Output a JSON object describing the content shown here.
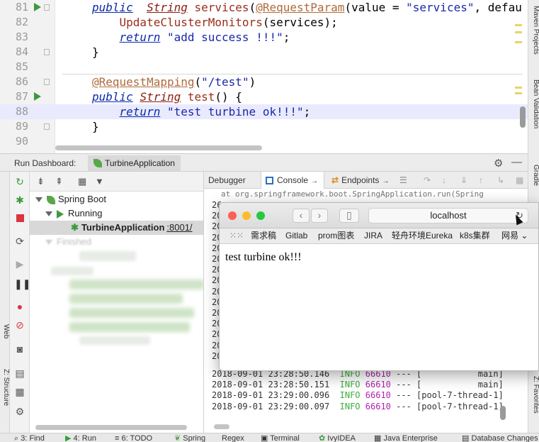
{
  "editor": {
    "lines": [
      {
        "num": "81",
        "run": true,
        "fold": true,
        "parts": [
          [
            "kw",
            "public"
          ],
          [
            "",
            "  "
          ],
          [
            "ty",
            "String"
          ],
          [
            "",
            ""
          ],
          [
            "fn",
            " services"
          ],
          [
            "",
            "("
          ],
          [
            "an",
            "@RequestParam"
          ],
          [
            "",
            "(value = "
          ],
          [
            "st",
            "\"services\""
          ],
          [
            "",
            ", defau"
          ]
        ]
      },
      {
        "num": "82",
        "run": false,
        "fold": false,
        "parts": [
          [
            "",
            "    "
          ],
          [
            "fn",
            "UpdateClusterMonitors"
          ],
          [
            "",
            "(services);"
          ]
        ]
      },
      {
        "num": "83",
        "run": false,
        "fold": false,
        "parts": [
          [
            "",
            "    "
          ],
          [
            "kw",
            "return"
          ],
          [
            "st",
            " \"add success !!!\""
          ],
          [
            "",
            ";"
          ]
        ]
      },
      {
        "num": "84",
        "run": false,
        "fold": true,
        "parts": [
          [
            "",
            "}"
          ]
        ]
      },
      {
        "num": "85",
        "run": false,
        "fold": false,
        "parts": []
      },
      {
        "num": "86",
        "run": false,
        "fold": true,
        "parts": [
          [
            "an",
            "@RequestMapping"
          ],
          [
            "",
            "("
          ],
          [
            "st",
            "\"/test\""
          ],
          [
            "",
            ")"
          ]
        ]
      },
      {
        "num": "87",
        "run": true,
        "fold": false,
        "parts": [
          [
            "kw",
            "public"
          ],
          [
            "",
            " "
          ],
          [
            "ty",
            "String"
          ],
          [
            "fn",
            " test"
          ],
          [
            "",
            "() {"
          ]
        ]
      },
      {
        "num": "88",
        "run": false,
        "fold": false,
        "highlight": true,
        "parts": [
          [
            "",
            "    "
          ],
          [
            "kw",
            "return"
          ],
          [
            "st",
            " \"test turbine ok!!!\""
          ],
          [
            "",
            ";"
          ]
        ]
      },
      {
        "num": "89",
        "run": false,
        "fold": true,
        "parts": [
          [
            "",
            "}"
          ]
        ]
      },
      {
        "num": "90",
        "run": false,
        "fold": false,
        "parts": []
      }
    ]
  },
  "right_strip": {
    "tabs": [
      "Maven Projects",
      "Bean Validation",
      "Gradle",
      "Z: Favorites"
    ]
  },
  "dashboard": {
    "title": "Run Dashboard:",
    "app_tab": "TurbineApplication"
  },
  "left_strip": {
    "tabs": [
      "Web",
      "Z: Structure"
    ]
  },
  "tree": {
    "spring_boot": "Spring Boot",
    "running": "Running",
    "app": "TurbineApplication",
    "port": ":8001/",
    "finished": "Finished"
  },
  "console": {
    "tabs": {
      "debugger": "Debugger",
      "console": "Console",
      "endpoints": "Endpoints"
    },
    "top_line": "at org.springframework.boot.SpringApplication.run(Spring",
    "truncated_prefix": "20",
    "truncated_first": "26",
    "logs": [
      {
        "ts": "2018-09-01 23:28:50.146",
        "level": "INFO",
        "pid": "66610",
        "sep": "--- [",
        "thread": "           main]"
      },
      {
        "ts": "2018-09-01 23:28:50.151",
        "level": "INFO",
        "pid": "66610",
        "sep": "--- [",
        "thread": "           main]"
      },
      {
        "ts": "2018-09-01 23:29:00.096",
        "level": "INFO",
        "pid": "66610",
        "sep": "--- [",
        "thread": "pool-7-thread-1]"
      },
      {
        "ts": "2018-09-01 23:29:00.097",
        "level": "INFO",
        "pid": "66610",
        "sep": "--- [",
        "thread": "pool-7-thread-1]"
      }
    ]
  },
  "browser": {
    "url": "localhost",
    "bookmarks": [
      "需求稿",
      "Gitlab",
      "prom图表",
      "JIRA",
      "轻舟环境Eureka",
      "k8s集群",
      "网易"
    ],
    "content": "test turbine ok!!!"
  },
  "status_bar": {
    "items": [
      "3: Find",
      "4: Run",
      "6: TODO",
      "Spring",
      "Regex",
      "Terminal",
      "IvyIDEA",
      "Java Enterprise",
      "Database Changes"
    ]
  },
  "colors": {
    "keyword": "#0a2aa6",
    "annotation": "#b06a3a",
    "string": "#1a28a8",
    "info": "#3cae3c",
    "pid": "#b022b0",
    "run_green": "#3c9a3c"
  }
}
